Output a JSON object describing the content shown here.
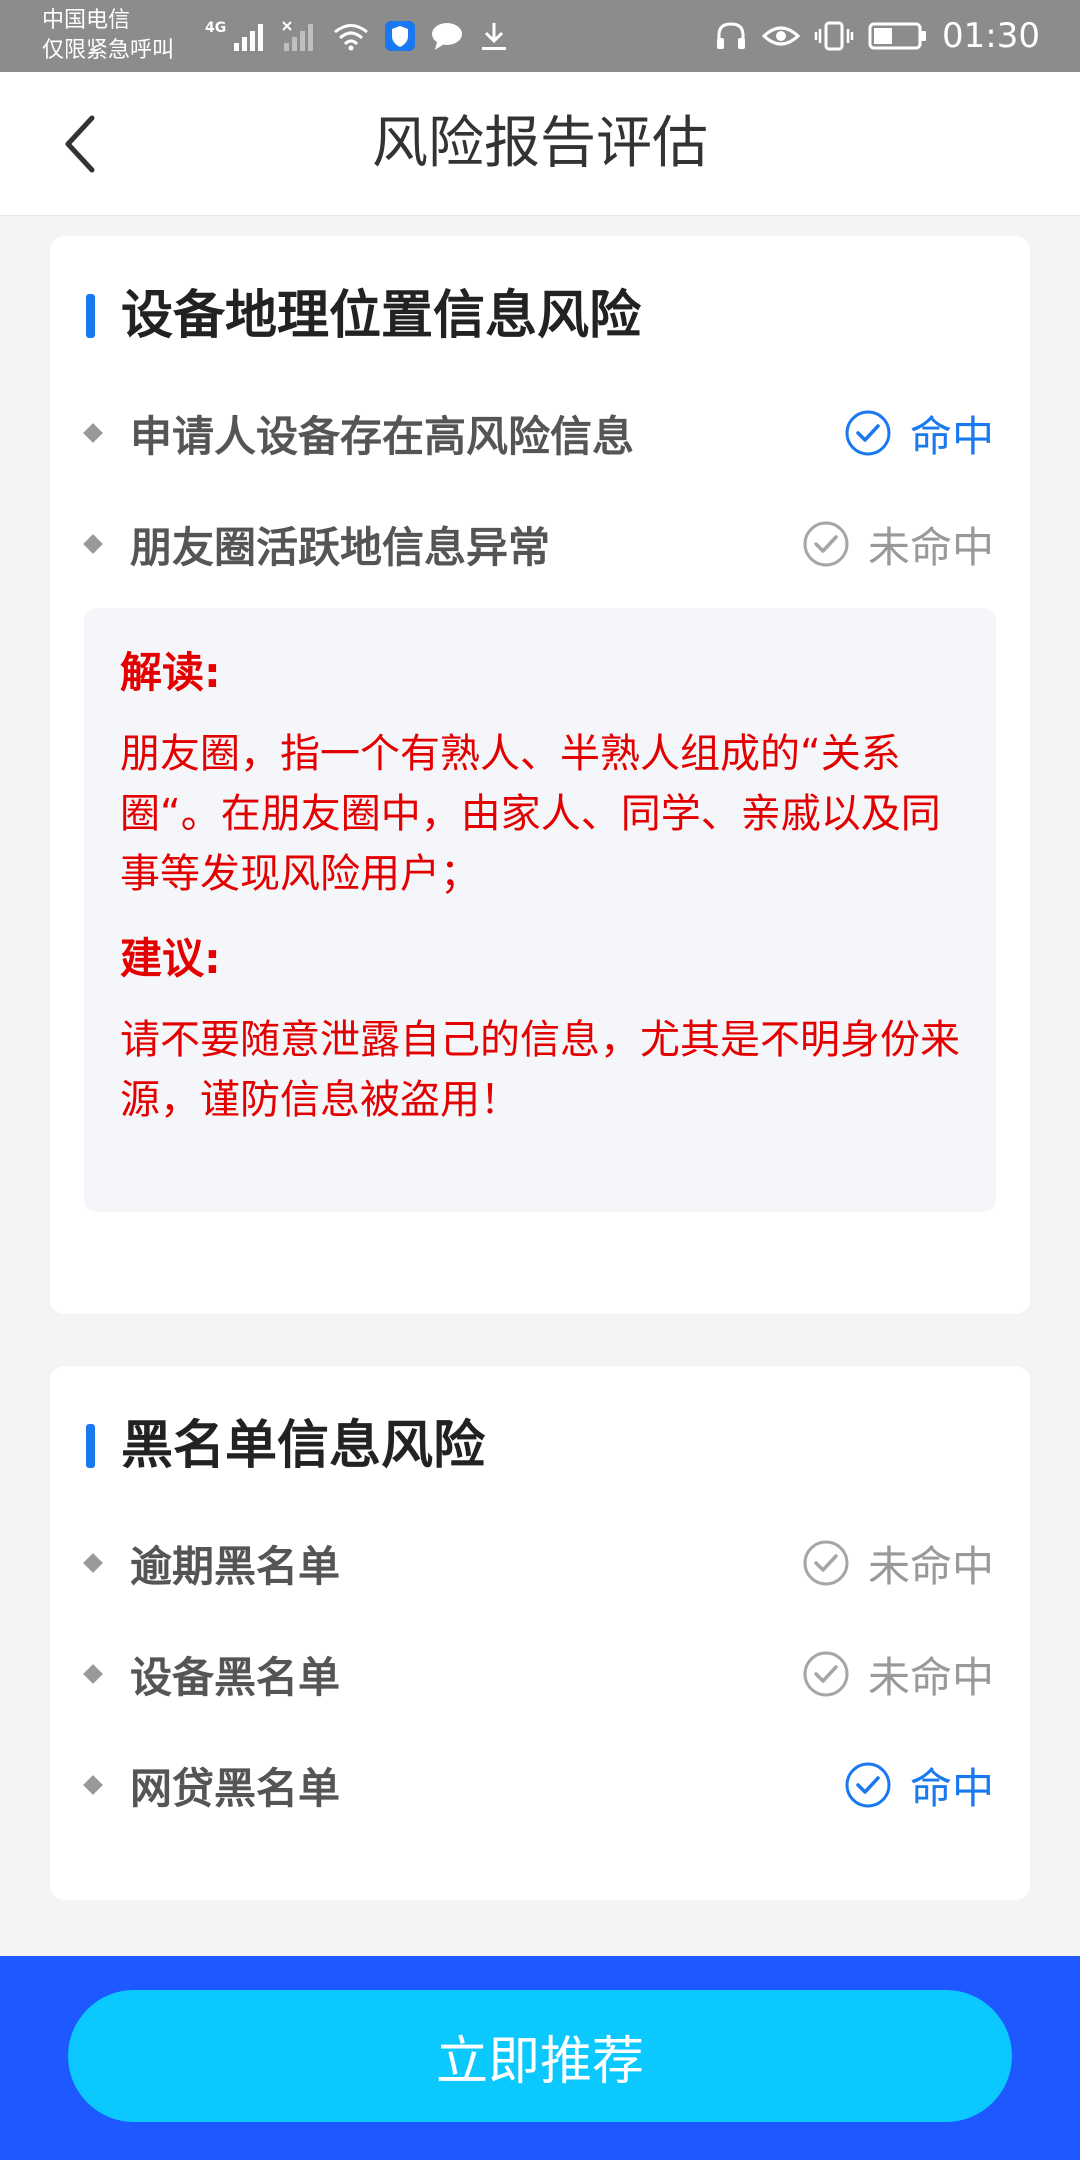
{
  "status_bar": {
    "carrier_line1": "中国电信",
    "carrier_line2": "仅限紧急呼叫",
    "network": "4G",
    "time": "01:30"
  },
  "header": {
    "title": "风险报告评估"
  },
  "sections": [
    {
      "title": "设备地理位置信息风险",
      "items": [
        {
          "label": "申请人设备存在高风险信息",
          "status": "命中",
          "hit": true
        },
        {
          "label": "朋友圈活跃地信息异常",
          "status": "未命中",
          "hit": false
        }
      ],
      "note": {
        "interpretation_heading": "解读:",
        "interpretation_text": "朋友圈，指一个有熟人、半熟人组成的“关系圈“。在朋友圈中，由家人、同学、亲戚以及同事等发现风险用户；",
        "advice_heading": "建议:",
        "advice_text": "请不要随意泄露自己的信息，尤其是不明身份来源，谨防信息被盗用！"
      }
    },
    {
      "title": "黑名单信息风险",
      "items": [
        {
          "label": "逾期黑名单",
          "status": "未命中",
          "hit": false
        },
        {
          "label": "设备黑名单",
          "status": "未命中",
          "hit": false
        },
        {
          "label": "网贷黑名单",
          "status": "命中",
          "hit": true
        }
      ]
    }
  ],
  "cta": {
    "label": "立即推荐"
  },
  "colors": {
    "accent": "#1a79f0",
    "warning_text": "#e40000",
    "cta_background": "#0bc8ff",
    "bottom_bar": "#1e59ff"
  }
}
